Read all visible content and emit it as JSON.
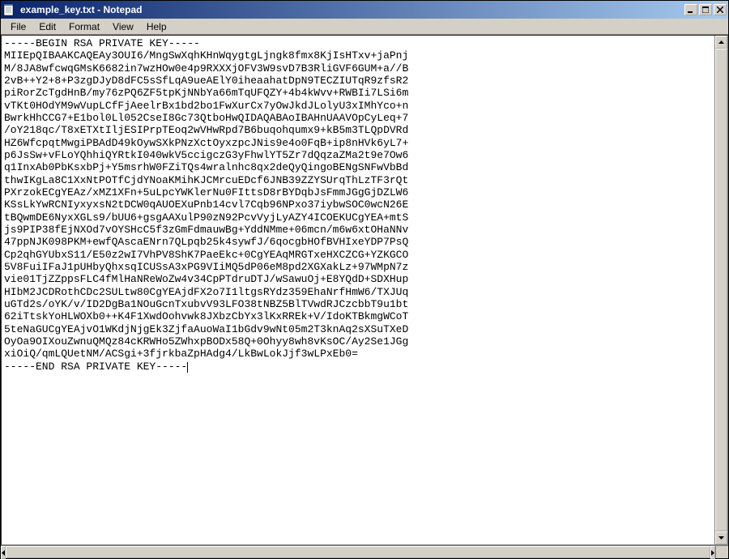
{
  "window": {
    "title": "example_key.txt - Notepad",
    "icon": "notepad-icon"
  },
  "menu": {
    "items": [
      "File",
      "Edit",
      "Format",
      "View",
      "Help"
    ]
  },
  "buttons": {
    "minimize": "_",
    "maximize": "□",
    "close": "✕"
  },
  "scroll": {
    "up": "▲",
    "down": "▼",
    "left": "◀",
    "right": "▶"
  },
  "content": "-----BEGIN RSA PRIVATE KEY-----\nMIIEpQIBAAKCAQEAy3OUI6/MngSwXqhKHnWqygtgLjngk8fmx8KjIsHTxv+jaPnj\nM/8JA8wfcwqGMsK6682in7wzHOw0e4p9RXXXjOFV3W9svD7B3RliGVF6GUM+a//B\n2vB++Y2+8+P3zgDJyD8dFC5sSfLqA9ueAElY0iheaahatDpN9TECZIUTqR9zfsR2\npiRorZcTgdHnB/my76zPQ6ZF5tpKjNNbYa66mTqUFQZY+4b4kWvv+RWBIi7LSi6m\nvTKt0HOdYM9wVupLCfFjAeelrBx1bd2bo1FwXurCx7yOwJkdJLolyU3xIMhYco+n\nBwrkHhCCG7+E1bol0Ll052CseI8Gc73QtboHwQIDAQABAoIBAHnUAAVOpCyLeq+7\n/oY218qc/T8xETXtIljESIPrpTEoq2wVHwRpd7B6buqohqumx9+kB5m3TLQpDVRd\nHZ6WfcpqtMwgiPBAdD49kOywSXkPNzXctOyxzpcJNis9e4o0FqB+ip8nHVk6yL7+\np6JsSw+vFLoYQhhiQYRtkI040wkV5ccigczG3yFhwlYT5Zr7dQqzaZMa2t9e7Ow6\nq1InxAb0PbKsxbPj+Y5msrhW0FZiTQs4wralnhc8qx2deQyQingoBENgSNFwVbBd\nthwIKgLa8C1XxNtPOTfCjdYNoaKMihKJCMrcuEDcf6JNB39ZZYSUrqThLzTF3rQt\nPXrzokECgYEAz/xMZ1XFn+5uLpcYWKlerNu0FIttsD8rBYDqbJsFmmJGgGjDZLW6\nKSsLkYwRCNIyxyxsN2tDCW0qAUOEXuPnb14cvl7Cqb96NPxo37iybwSOC0wcN26E\ntBQwmDE6NyxXGLs9/bUU6+gsgAAXulP90zN92PcvVyjLyAZY4ICOEKUCgYEA+mtS\njs9PIP38fEjNXOd7vOYSHcC5f3zGmFdmauwBg+YddNMme+06mcn/m6w6xtOHaNNv\n47ppNJK098PKM+ewfQAscaENrn7QLpqb25k4sywfJ/6qocgbHOfBVHIxeYDP7PsQ\nCp2qhGYUbxS11/E50z2wI7VhPV8ShK7PaeEkc+0CgYEAqMRGTxeHXCZCG+YZKGCO\n5V8FuiIFaJ1pUHbyQhxsqICUSsA3xPG9VIiMQ5dP06eM8pd2XGXakLz+97WMpN7z\nvie01TjZZppsFLC4fMlHaNReWoZw4v34CpPTdruDTJ/wSawuOj+E8YQdD+SDXHup\nHIbM2JCDRothCDc2SULtw80CgYEAjdFX2o7I1ltgsRYdz359EhaNrfHmW6/TXJUq\nuGTd2s/oYK/v/ID2DgBa1NOuGcnTxubvV93LFO38tNBZ5BlTVwdRJCzcbbT9u1bt\n62iTtskYoHLWOXb0++K4F1XwdOohvwk8JXbzCbYx3lKxRREk+V/IdoKTBkmgWCoT\n5teNaGUCgYEAjvO1WKdjNjgEk3ZjfaAuoWaI1bGdv9wNt05m2T3knAq2sXSuTXeD\nOyOa9OIXouZwnuQMQz84cKRWHo5ZWhxpBODx58Q+0Ohyy8wh8vKsOC/Ay2Se1JGg\nxiOiQ/qmLQUetNM/ACSgi+3fjrkbaZpHAdg4/LkBwLokJjf3wLPxEb0=\n-----END RSA PRIVATE KEY-----"
}
